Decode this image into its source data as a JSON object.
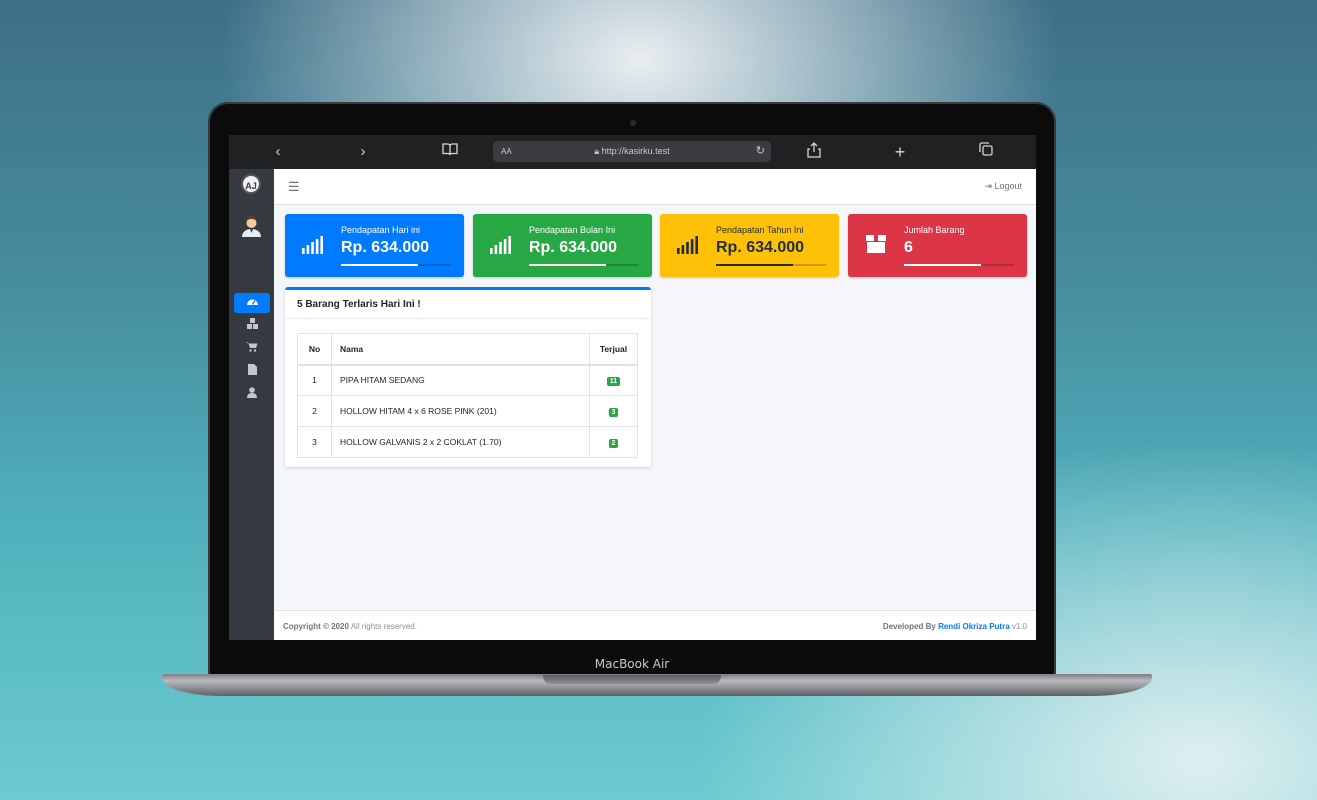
{
  "device": {
    "label": "MacBook Air"
  },
  "browser": {
    "text_size": "AA",
    "url": "http://kasirku.test"
  },
  "app": {
    "logo": "AJ",
    "logout": "Logout"
  },
  "cards": [
    {
      "label": "Pendapatan Hari ini",
      "value": "Rp. 634.000",
      "color": "#007bff",
      "icon": "signal-icon",
      "progress": 0.7
    },
    {
      "label": "Pendapatan Bulan Ini",
      "value": "Rp. 634.000",
      "color": "#28a745",
      "icon": "signal-icon",
      "progress": 0.7
    },
    {
      "label": "Pendapatan Tahun Ini",
      "value": "Rp. 634.000",
      "color": "#ffc107",
      "icon": "signal-icon",
      "progress": 0.7
    },
    {
      "label": "Jumlah Barang",
      "value": "6",
      "color": "#dc3545",
      "icon": "box-icon",
      "progress": 0.7
    }
  ],
  "top_items": {
    "title": "5 Barang Terlaris Hari Ini !",
    "headers": {
      "no": "No",
      "name": "Nama",
      "sold": "Terjual"
    },
    "rows": [
      {
        "no": "1",
        "name": "PIPA HITAM SEDANG",
        "sold": "11"
      },
      {
        "no": "2",
        "name": "HOLLOW HITAM 4 x 6 ROSE PINK (201)",
        "sold": "3"
      },
      {
        "no": "3",
        "name": "HOLLOW GALVANIS 2 x 2 COKLAT (1.70)",
        "sold": "2"
      }
    ]
  },
  "footer": {
    "copyright_bold": "Copyright © 2020",
    "copyright_rest": "All rights reserved.",
    "dev_prefix": "Developed By",
    "dev_name": "Rendi Okriza Putra",
    "version": "v1.0"
  }
}
